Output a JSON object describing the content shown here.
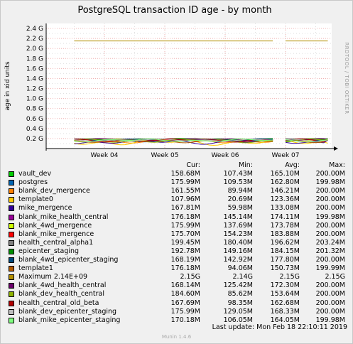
{
  "chart_data": {
    "type": "line",
    "title": "PostgreSQL transaction ID age - by month",
    "ylabel": "age in xid units",
    "side_label": "RRDTOOL / TOBI OETIKER",
    "yticks": [
      "0.2 G",
      "0.4 G",
      "0.6 G",
      "0.8 G",
      "1.0 G",
      "1.2 G",
      "1.4 G",
      "1.6 G",
      "1.8 G",
      "2.0 G",
      "2.2 G",
      "2.4 G"
    ],
    "ytick_values": [
      0.2,
      0.4,
      0.6,
      0.8,
      1.0,
      1.2,
      1.4,
      1.6,
      1.8,
      2.0,
      2.2,
      2.4
    ],
    "ylim": [
      0,
      2.5
    ],
    "xticks": [
      "Week 04",
      "Week 05",
      "Week 06",
      "Week 07"
    ],
    "grid": true,
    "maximum_series_value_g": 2.15,
    "gap_weeks": [
      6.8,
      6.95
    ],
    "series_range_weeks": [
      3.5,
      7.7
    ],
    "columns": [
      "Cur:",
      "Min:",
      "Avg:",
      "Max:"
    ],
    "series": [
      {
        "name": "vault_dev",
        "color": "#00cc00",
        "cur": "158.68M",
        "min": "107.43M",
        "avg": "165.10M",
        "max": "200.00M"
      },
      {
        "name": "postgres",
        "color": "#0066b3",
        "cur": "175.99M",
        "min": "109.53M",
        "avg": "162.80M",
        "max": "199.98M"
      },
      {
        "name": "blank_dev_mergence",
        "color": "#ff8000",
        "cur": "161.55M",
        "min": "89.94M",
        "avg": "146.21M",
        "max": "200.00M"
      },
      {
        "name": "template0",
        "color": "#ffcc00",
        "cur": "107.96M",
        "min": "20.69M",
        "avg": "123.36M",
        "max": "200.00M"
      },
      {
        "name": "mike_mergence",
        "color": "#330099",
        "cur": "167.81M",
        "min": "59.98M",
        "avg": "133.08M",
        "max": "200.00M"
      },
      {
        "name": "blank_mike_health_central",
        "color": "#990099",
        "cur": "176.18M",
        "min": "145.14M",
        "avg": "174.11M",
        "max": "199.98M"
      },
      {
        "name": "blank_4wd_mergence",
        "color": "#ccff00",
        "cur": "175.99M",
        "min": "137.69M",
        "avg": "173.78M",
        "max": "200.00M"
      },
      {
        "name": "blank_mike_mergence",
        "color": "#ff0000",
        "cur": "175.70M",
        "min": "154.23M",
        "avg": "183.88M",
        "max": "200.00M"
      },
      {
        "name": "health_central_alpha1",
        "color": "#808080",
        "cur": "199.45M",
        "min": "180.40M",
        "avg": "196.62M",
        "max": "203.24M"
      },
      {
        "name": "epicenter_staging",
        "color": "#008f00",
        "cur": "192.78M",
        "min": "149.16M",
        "avg": "184.15M",
        "max": "201.32M"
      },
      {
        "name": "blank_4wd_epicenter_staging",
        "color": "#00487d",
        "cur": "168.19M",
        "min": "142.92M",
        "avg": "177.80M",
        "max": "200.00M"
      },
      {
        "name": "template1",
        "color": "#b35a00",
        "cur": "176.18M",
        "min": "94.06M",
        "avg": "150.73M",
        "max": "199.99M"
      },
      {
        "name": "Maximum 2.14E+09",
        "color": "#b38f00",
        "cur": "2.15G",
        "min": "2.14G",
        "avg": "2.15G",
        "max": "2.15G"
      },
      {
        "name": "blank_4wd_health_central",
        "color": "#6b006b",
        "cur": "168.14M",
        "min": "125.42M",
        "avg": "172.30M",
        "max": "200.00M"
      },
      {
        "name": "blank_dev_health_central",
        "color": "#8fb300",
        "cur": "184.60M",
        "min": "85.62M",
        "avg": "153.64M",
        "max": "200.00M"
      },
      {
        "name": "health_central_old_beta",
        "color": "#b30000",
        "cur": "167.69M",
        "min": "98.35M",
        "avg": "162.68M",
        "max": "200.00M"
      },
      {
        "name": "blank_dev_epicenter_staging",
        "color": "#bebebe",
        "cur": "175.99M",
        "min": "129.05M",
        "avg": "168.33M",
        "max": "200.00M"
      },
      {
        "name": "blank_mike_epicenter_staging",
        "color": "#80ff80",
        "cur": "170.18M",
        "min": "106.05M",
        "avg": "164.05M",
        "max": "199.98M"
      }
    ]
  },
  "footer": {
    "last_update": "Last update:  Mon Feb 18 22:10:11 2019",
    "munin": "Munin 1.4.6"
  }
}
